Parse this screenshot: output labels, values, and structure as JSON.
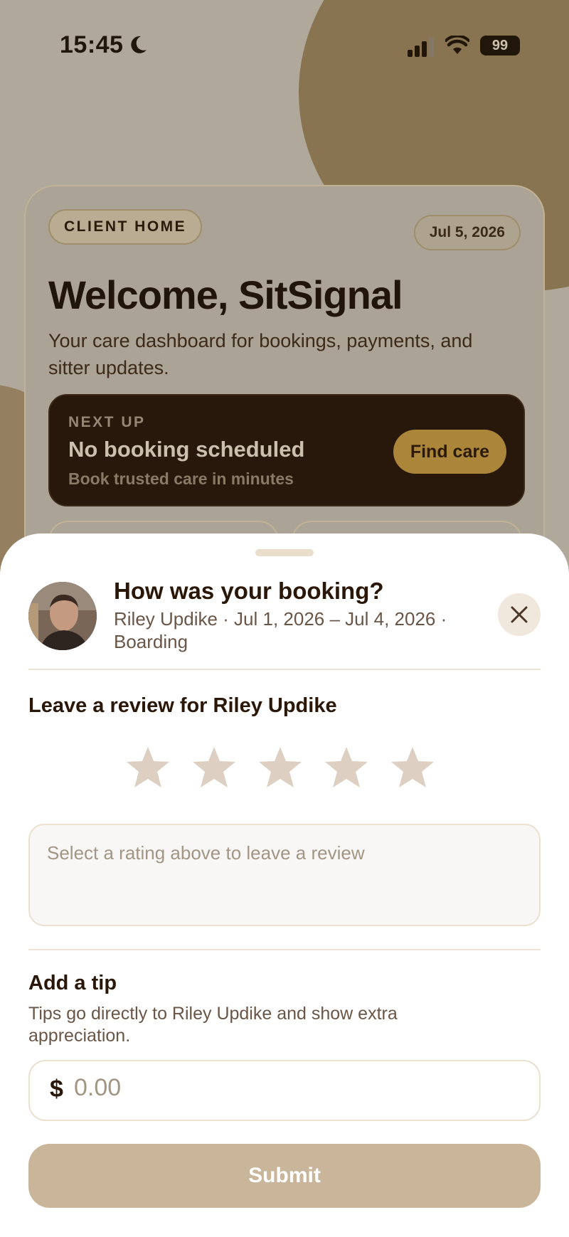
{
  "status_bar": {
    "time": "15:45",
    "battery": "99"
  },
  "dashboard": {
    "badge": "CLIENT HOME",
    "date": "Jul 5, 2026",
    "welcome": "Welcome, SitSignal",
    "subtitle": "Your care dashboard for bookings, payments, and sitter updates.",
    "next_up": {
      "label": "NEXT UP",
      "title": "No booking scheduled",
      "subtitle": "Book trusted care in minutes",
      "button": "Find care"
    }
  },
  "review_sheet": {
    "title": "How was your booking?",
    "meta": "Riley Updike · Jul 1, 2026 – Jul 4, 2026 · Boarding",
    "review_heading": "Leave a review for Riley Updike",
    "rating": 0,
    "max_rating": 5,
    "review_placeholder": "Select a rating above to leave a review",
    "tip_heading": "Add a tip",
    "tip_description": "Tips go directly to Riley Updike and show extra appreciation.",
    "currency_symbol": "$",
    "tip_placeholder": "0.00",
    "submit_label": "Submit"
  },
  "colors": {
    "accent_gold": "#b58d3c",
    "dark_brown": "#26160b",
    "star_inactive": "#ddd0c2",
    "submit_disabled": "#c9b69a"
  },
  "icons": {
    "close": "close-icon",
    "star": "star-icon",
    "moon": "moon-icon",
    "signal": "cellular-signal-icon",
    "wifi": "wifi-icon"
  }
}
